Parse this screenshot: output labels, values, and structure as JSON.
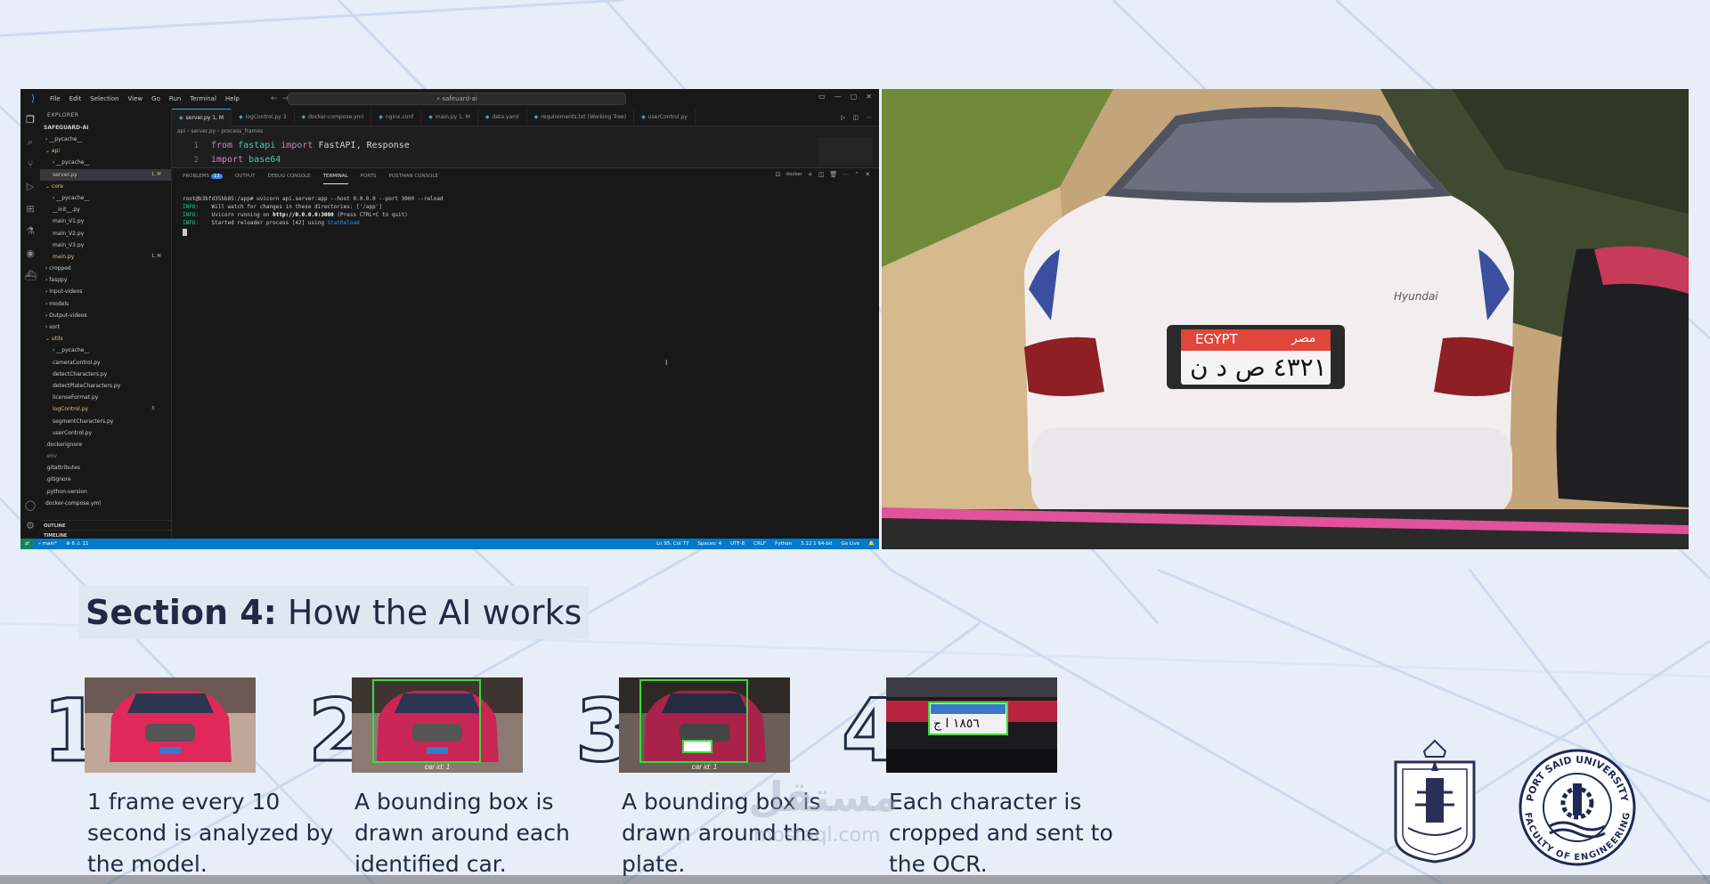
{
  "vscode": {
    "menu": [
      "File",
      "Edit",
      "Selection",
      "View",
      "Go",
      "Run",
      "Terminal",
      "Help"
    ],
    "search": "safeuard-ai",
    "explorer_title": "EXPLORER",
    "project": "SAFEGUARD-AI",
    "tree": [
      {
        "label": "› __pycache__",
        "indent": 6,
        "status": "",
        "color": "#cccccc"
      },
      {
        "label": "⌄ api",
        "indent": 6,
        "status": "",
        "color": "#e2c08d"
      },
      {
        "label": "› __pycache__",
        "indent": 14,
        "status": "",
        "color": "#cccccc"
      },
      {
        "label": "server.py",
        "indent": 14,
        "status": "1, M",
        "color": "#e2c08d",
        "selected": true
      },
      {
        "label": "⌄ core",
        "indent": 6,
        "status": "",
        "color": "#e2c08d"
      },
      {
        "label": "› __pycache__",
        "indent": 14,
        "status": "",
        "color": "#cccccc"
      },
      {
        "label": "__init__.py",
        "indent": 14,
        "status": "",
        "color": "#cccccc"
      },
      {
        "label": "main_V1.py",
        "indent": 14,
        "status": "",
        "color": "#cccccc"
      },
      {
        "label": "main_V2.py",
        "indent": 14,
        "status": "",
        "color": "#cccccc"
      },
      {
        "label": "main_V3.py",
        "indent": 14,
        "status": "",
        "color": "#cccccc"
      },
      {
        "label": "main.py",
        "indent": 14,
        "status": "1, M",
        "color": "#e2c08d"
      },
      {
        "label": "› cropped",
        "indent": 6,
        "status": "",
        "color": "#cccccc"
      },
      {
        "label": "› fasppy",
        "indent": 6,
        "status": "",
        "color": "#cccccc"
      },
      {
        "label": "› Input-videos",
        "indent": 6,
        "status": "",
        "color": "#cccccc"
      },
      {
        "label": "› models",
        "indent": 6,
        "status": "",
        "color": "#cccccc"
      },
      {
        "label": "› Output-videos",
        "indent": 6,
        "status": "",
        "color": "#cccccc"
      },
      {
        "label": "› sort",
        "indent": 6,
        "status": "",
        "color": "#cccccc"
      },
      {
        "label": "⌄ utils",
        "indent": 6,
        "status": "",
        "color": "#e2c08d"
      },
      {
        "label": "› __pycache__",
        "indent": 14,
        "status": "",
        "color": "#cccccc"
      },
      {
        "label": "cameraControl.py",
        "indent": 14,
        "status": "",
        "color": "#cccccc"
      },
      {
        "label": "detectCharacters.py",
        "indent": 14,
        "status": "",
        "color": "#cccccc"
      },
      {
        "label": "detectPlateCharacters.py",
        "indent": 14,
        "status": "",
        "color": "#cccccc"
      },
      {
        "label": "licenseFormat.py",
        "indent": 14,
        "status": "",
        "color": "#cccccc"
      },
      {
        "label": "logControl.py",
        "indent": 14,
        "status": "3",
        "color": "#e2c08d"
      },
      {
        "label": "segmentCharacters.py",
        "indent": 14,
        "status": "",
        "color": "#cccccc"
      },
      {
        "label": "userControl.py",
        "indent": 14,
        "status": "",
        "color": "#cccccc"
      },
      {
        "label": ".dockerignore",
        "indent": 6,
        "status": "",
        "color": "#cccccc"
      },
      {
        "label": ".env",
        "indent": 6,
        "status": "",
        "color": "#8a8a8a"
      },
      {
        "label": ".gitattributes",
        "indent": 6,
        "status": "",
        "color": "#cccccc"
      },
      {
        "label": ".gitignore",
        "indent": 6,
        "status": "",
        "color": "#cccccc"
      },
      {
        "label": ".python-version",
        "indent": 6,
        "status": "",
        "color": "#cccccc"
      },
      {
        "label": "docker-compose.yml",
        "indent": 6,
        "status": "",
        "color": "#cccccc"
      }
    ],
    "outline": "OUTLINE",
    "timeline": "TIMELINE",
    "tabs": [
      {
        "label": "server.py 1, M",
        "active": true
      },
      {
        "label": "logControl.py 3",
        "active": false
      },
      {
        "label": "docker-compose.yml",
        "active": false
      },
      {
        "label": "nginx.conf",
        "active": false
      },
      {
        "label": "main.py 1, M",
        "active": false
      },
      {
        "label": "data.yaml",
        "active": false
      },
      {
        "label": "requirements.txt (Working Tree)",
        "active": false
      },
      {
        "label": "userControl.py",
        "active": false
      }
    ],
    "breadcrumb": "api › server.py › process_frames",
    "code": [
      {
        "n": "1",
        "kw": "from ",
        "mod": "fastapi",
        "rest1": " import ",
        "rest2": "FastAPI, Response"
      },
      {
        "n": "2",
        "kw": "import ",
        "mod": "base64",
        "rest1": "",
        "rest2": ""
      }
    ],
    "panel_tabs": [
      "PROBLEMS",
      "OUTPUT",
      "DEBUG CONSOLE",
      "TERMINAL",
      "PORTS",
      "POSTMAN CONSOLE"
    ],
    "problems_count": "11",
    "shell_label": "docker",
    "terminal": {
      "line1": "root@b3bfd35bb85:/app# uvicorn api.server:app --host 0.0.0.0 --port 3000 --reload",
      "line2_tag": "INFO:",
      "line2": "    Will watch for changes in these directories: ['/app']",
      "line3_tag": "INFO:",
      "line3_a": "    Uvicorn running on ",
      "line3_url": "http://0.0.0.0:3000",
      "line3_b": " (Press CTRL+C to quit)",
      "line4_tag": "INFO:",
      "line4_a": "    Started reloader process [42] using ",
      "line4_b": "StatReload"
    },
    "status": {
      "branch": "main*",
      "errors": "⊗ 6 ⚠ 11",
      "position": "Ln 95, Col 77",
      "spaces": "Spaces: 4",
      "encoding": "UTF-8",
      "eol": "CRLF",
      "language": "Python",
      "interpreter": "3.12.1 64-bit",
      "golive": "Go Live"
    }
  },
  "slide": {
    "section_bold": "Section 4:",
    "section_rest": "How the AI works",
    "steps": [
      {
        "num": "1",
        "text": "1 frame every 10 second is analyzed by the model.",
        "caption": ""
      },
      {
        "num": "2",
        "text": "A bounding box is drawn around each identified car.",
        "caption": "car id: 1"
      },
      {
        "num": "3",
        "text": "A bounding box is drawn around the plate.",
        "caption": "car id: 1"
      },
      {
        "num": "4",
        "text": "Each character is cropped and sent to the OCR.",
        "caption": ""
      }
    ],
    "watermark": "مستقل",
    "watermark_sub": "mostaql.com",
    "university": "PORT SAID UNIVERSITY",
    "faculty": "FACULTY OF ENGINEERING"
  },
  "photo": {
    "plate_country": "EGYPT",
    "plate_country_ar": "مصر",
    "plate_number": "٤٣٢١ ص د ن",
    "car_model": "Hyundai"
  },
  "colors": {
    "accent": "#007acc",
    "slide_text": "#1f2a44",
    "plate_red": "#e0463a"
  }
}
